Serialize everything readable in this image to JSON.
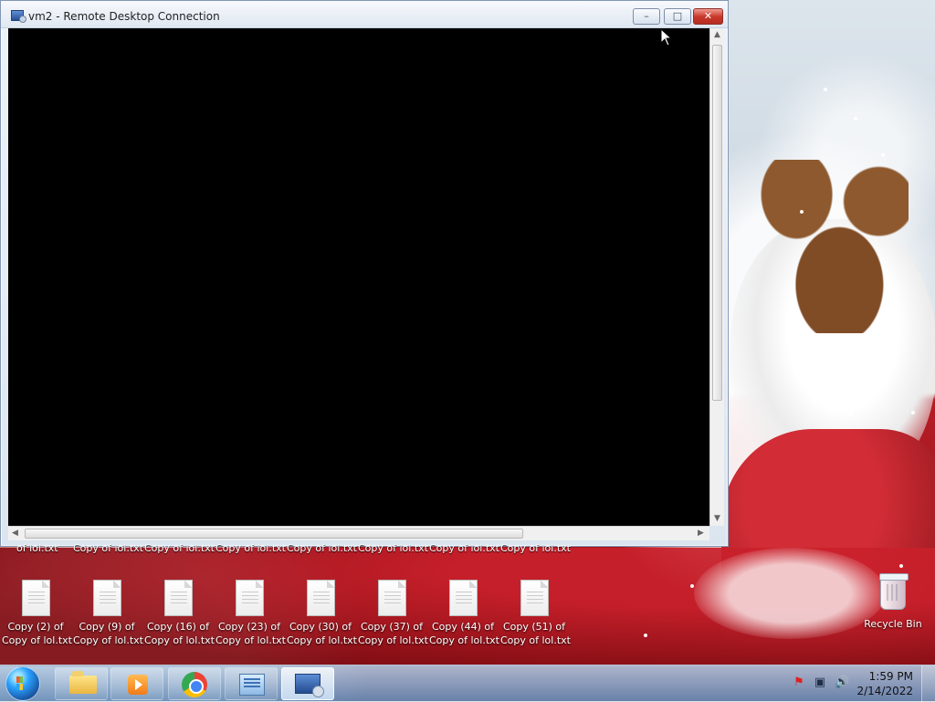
{
  "window": {
    "title": "vm2 - Remote Desktop Connection",
    "controls": {
      "minimize": "–",
      "maximize": "□",
      "close": "✕"
    }
  },
  "desktop": {
    "top_row_labels": [
      "of lol.txt",
      "Copy of lol.txt",
      "Copy of lol.txt",
      "Copy of lol.txt",
      "Copy of lol.txt",
      "Copy of lol.txt",
      "Copy of lol.txt",
      "Copy of lol.txt"
    ],
    "icons": [
      {
        "line1": "Copy (2) of",
        "line2": "Copy of lol.txt"
      },
      {
        "line1": "Copy (9) of",
        "line2": "Copy of lol.txt"
      },
      {
        "line1": "Copy (16) of",
        "line2": "Copy of lol.txt"
      },
      {
        "line1": "Copy (23) of",
        "line2": "Copy of lol.txt"
      },
      {
        "line1": "Copy (30) of",
        "line2": "Copy of lol.txt"
      },
      {
        "line1": "Copy (37) of",
        "line2": "Copy of lol.txt"
      },
      {
        "line1": "Copy (44) of",
        "line2": "Copy of lol.txt"
      },
      {
        "line1": "Copy (51) of",
        "line2": "Copy of lol.txt"
      }
    ],
    "recycle_bin": "Recycle Bin"
  },
  "taskbar": {
    "time": "1:59 PM",
    "date": "2/14/2022",
    "icons": {
      "start": "windows-start-icon",
      "explorer": "folder-icon",
      "media": "media-player-icon",
      "chrome": "chrome-icon",
      "manager": "server-manager-icon",
      "rdp": "remote-desktop-icon"
    }
  }
}
